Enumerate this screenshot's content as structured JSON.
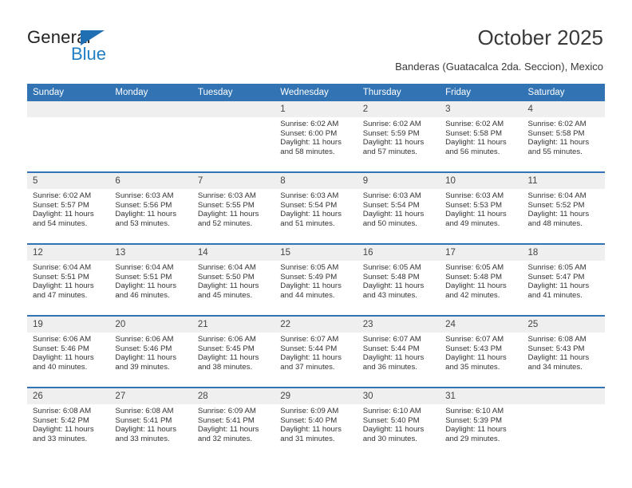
{
  "brand": {
    "name_top": "General",
    "name_bottom": "Blue",
    "triangle_color": "#1f6fb2",
    "blue_text_color": "#1f7ec4"
  },
  "header": {
    "title": "October 2025",
    "subtitle": "Banderas (Guatacalca 2da. Seccion), Mexico"
  },
  "colors": {
    "header_blue": "#3273b4",
    "daynum_gray": "#efefef",
    "text": "#333333"
  },
  "weekday_headers": [
    "Sunday",
    "Monday",
    "Tuesday",
    "Wednesday",
    "Thursday",
    "Friday",
    "Saturday"
  ],
  "weeks": [
    [
      {
        "day": "",
        "sunrise": "",
        "sunset": "",
        "daylight1": "",
        "daylight2": ""
      },
      {
        "day": "",
        "sunrise": "",
        "sunset": "",
        "daylight1": "",
        "daylight2": ""
      },
      {
        "day": "",
        "sunrise": "",
        "sunset": "",
        "daylight1": "",
        "daylight2": ""
      },
      {
        "day": "1",
        "sunrise": "Sunrise: 6:02 AM",
        "sunset": "Sunset: 6:00 PM",
        "daylight1": "Daylight: 11 hours",
        "daylight2": "and 58 minutes."
      },
      {
        "day": "2",
        "sunrise": "Sunrise: 6:02 AM",
        "sunset": "Sunset: 5:59 PM",
        "daylight1": "Daylight: 11 hours",
        "daylight2": "and 57 minutes."
      },
      {
        "day": "3",
        "sunrise": "Sunrise: 6:02 AM",
        "sunset": "Sunset: 5:58 PM",
        "daylight1": "Daylight: 11 hours",
        "daylight2": "and 56 minutes."
      },
      {
        "day": "4",
        "sunrise": "Sunrise: 6:02 AM",
        "sunset": "Sunset: 5:58 PM",
        "daylight1": "Daylight: 11 hours",
        "daylight2": "and 55 minutes."
      }
    ],
    [
      {
        "day": "5",
        "sunrise": "Sunrise: 6:02 AM",
        "sunset": "Sunset: 5:57 PM",
        "daylight1": "Daylight: 11 hours",
        "daylight2": "and 54 minutes."
      },
      {
        "day": "6",
        "sunrise": "Sunrise: 6:03 AM",
        "sunset": "Sunset: 5:56 PM",
        "daylight1": "Daylight: 11 hours",
        "daylight2": "and 53 minutes."
      },
      {
        "day": "7",
        "sunrise": "Sunrise: 6:03 AM",
        "sunset": "Sunset: 5:55 PM",
        "daylight1": "Daylight: 11 hours",
        "daylight2": "and 52 minutes."
      },
      {
        "day": "8",
        "sunrise": "Sunrise: 6:03 AM",
        "sunset": "Sunset: 5:54 PM",
        "daylight1": "Daylight: 11 hours",
        "daylight2": "and 51 minutes."
      },
      {
        "day": "9",
        "sunrise": "Sunrise: 6:03 AM",
        "sunset": "Sunset: 5:54 PM",
        "daylight1": "Daylight: 11 hours",
        "daylight2": "and 50 minutes."
      },
      {
        "day": "10",
        "sunrise": "Sunrise: 6:03 AM",
        "sunset": "Sunset: 5:53 PM",
        "daylight1": "Daylight: 11 hours",
        "daylight2": "and 49 minutes."
      },
      {
        "day": "11",
        "sunrise": "Sunrise: 6:04 AM",
        "sunset": "Sunset: 5:52 PM",
        "daylight1": "Daylight: 11 hours",
        "daylight2": "and 48 minutes."
      }
    ],
    [
      {
        "day": "12",
        "sunrise": "Sunrise: 6:04 AM",
        "sunset": "Sunset: 5:51 PM",
        "daylight1": "Daylight: 11 hours",
        "daylight2": "and 47 minutes."
      },
      {
        "day": "13",
        "sunrise": "Sunrise: 6:04 AM",
        "sunset": "Sunset: 5:51 PM",
        "daylight1": "Daylight: 11 hours",
        "daylight2": "and 46 minutes."
      },
      {
        "day": "14",
        "sunrise": "Sunrise: 6:04 AM",
        "sunset": "Sunset: 5:50 PM",
        "daylight1": "Daylight: 11 hours",
        "daylight2": "and 45 minutes."
      },
      {
        "day": "15",
        "sunrise": "Sunrise: 6:05 AM",
        "sunset": "Sunset: 5:49 PM",
        "daylight1": "Daylight: 11 hours",
        "daylight2": "and 44 minutes."
      },
      {
        "day": "16",
        "sunrise": "Sunrise: 6:05 AM",
        "sunset": "Sunset: 5:48 PM",
        "daylight1": "Daylight: 11 hours",
        "daylight2": "and 43 minutes."
      },
      {
        "day": "17",
        "sunrise": "Sunrise: 6:05 AM",
        "sunset": "Sunset: 5:48 PM",
        "daylight1": "Daylight: 11 hours",
        "daylight2": "and 42 minutes."
      },
      {
        "day": "18",
        "sunrise": "Sunrise: 6:05 AM",
        "sunset": "Sunset: 5:47 PM",
        "daylight1": "Daylight: 11 hours",
        "daylight2": "and 41 minutes."
      }
    ],
    [
      {
        "day": "19",
        "sunrise": "Sunrise: 6:06 AM",
        "sunset": "Sunset: 5:46 PM",
        "daylight1": "Daylight: 11 hours",
        "daylight2": "and 40 minutes."
      },
      {
        "day": "20",
        "sunrise": "Sunrise: 6:06 AM",
        "sunset": "Sunset: 5:46 PM",
        "daylight1": "Daylight: 11 hours",
        "daylight2": "and 39 minutes."
      },
      {
        "day": "21",
        "sunrise": "Sunrise: 6:06 AM",
        "sunset": "Sunset: 5:45 PM",
        "daylight1": "Daylight: 11 hours",
        "daylight2": "and 38 minutes."
      },
      {
        "day": "22",
        "sunrise": "Sunrise: 6:07 AM",
        "sunset": "Sunset: 5:44 PM",
        "daylight1": "Daylight: 11 hours",
        "daylight2": "and 37 minutes."
      },
      {
        "day": "23",
        "sunrise": "Sunrise: 6:07 AM",
        "sunset": "Sunset: 5:44 PM",
        "daylight1": "Daylight: 11 hours",
        "daylight2": "and 36 minutes."
      },
      {
        "day": "24",
        "sunrise": "Sunrise: 6:07 AM",
        "sunset": "Sunset: 5:43 PM",
        "daylight1": "Daylight: 11 hours",
        "daylight2": "and 35 minutes."
      },
      {
        "day": "25",
        "sunrise": "Sunrise: 6:08 AM",
        "sunset": "Sunset: 5:43 PM",
        "daylight1": "Daylight: 11 hours",
        "daylight2": "and 34 minutes."
      }
    ],
    [
      {
        "day": "26",
        "sunrise": "Sunrise: 6:08 AM",
        "sunset": "Sunset: 5:42 PM",
        "daylight1": "Daylight: 11 hours",
        "daylight2": "and 33 minutes."
      },
      {
        "day": "27",
        "sunrise": "Sunrise: 6:08 AM",
        "sunset": "Sunset: 5:41 PM",
        "daylight1": "Daylight: 11 hours",
        "daylight2": "and 33 minutes."
      },
      {
        "day": "28",
        "sunrise": "Sunrise: 6:09 AM",
        "sunset": "Sunset: 5:41 PM",
        "daylight1": "Daylight: 11 hours",
        "daylight2": "and 32 minutes."
      },
      {
        "day": "29",
        "sunrise": "Sunrise: 6:09 AM",
        "sunset": "Sunset: 5:40 PM",
        "daylight1": "Daylight: 11 hours",
        "daylight2": "and 31 minutes."
      },
      {
        "day": "30",
        "sunrise": "Sunrise: 6:10 AM",
        "sunset": "Sunset: 5:40 PM",
        "daylight1": "Daylight: 11 hours",
        "daylight2": "and 30 minutes."
      },
      {
        "day": "31",
        "sunrise": "Sunrise: 6:10 AM",
        "sunset": "Sunset: 5:39 PM",
        "daylight1": "Daylight: 11 hours",
        "daylight2": "and 29 minutes."
      },
      {
        "day": "",
        "sunrise": "",
        "sunset": "",
        "daylight1": "",
        "daylight2": ""
      }
    ]
  ]
}
